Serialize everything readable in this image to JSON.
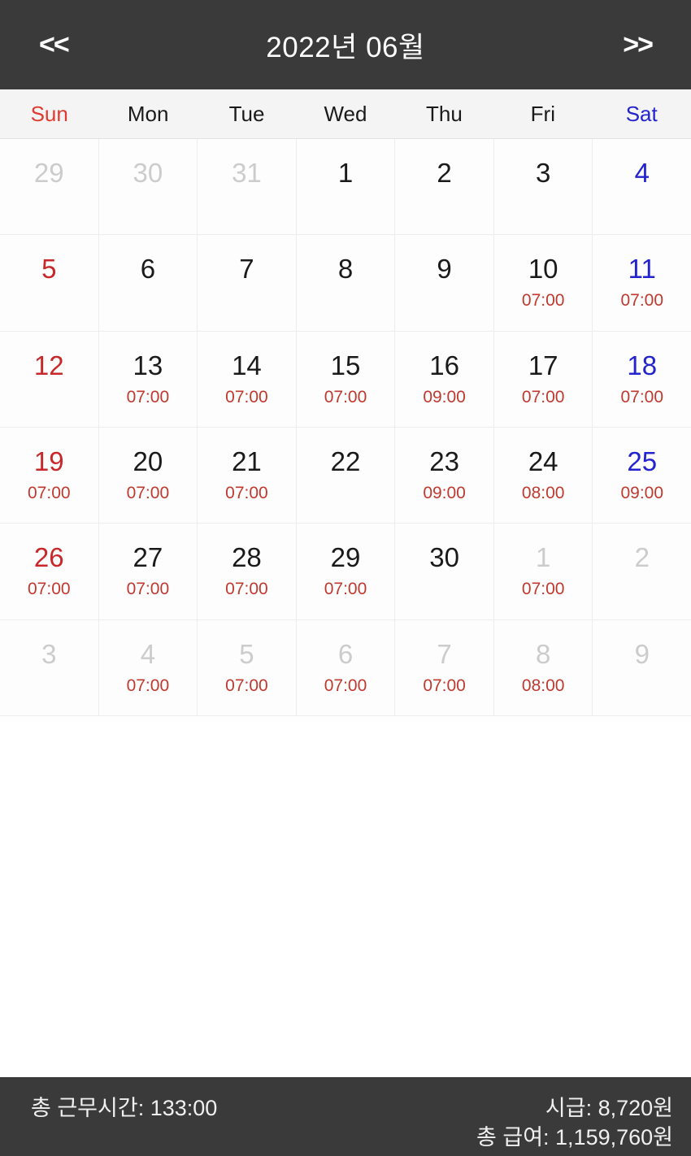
{
  "header": {
    "prev_label": "<<",
    "title": "2022년 06월",
    "next_label": ">>"
  },
  "weekdays": [
    {
      "label": "Sun",
      "kind": "sun"
    },
    {
      "label": "Mon",
      "kind": "weekday"
    },
    {
      "label": "Tue",
      "kind": "weekday"
    },
    {
      "label": "Wed",
      "kind": "weekday"
    },
    {
      "label": "Thu",
      "kind": "weekday"
    },
    {
      "label": "Fri",
      "kind": "weekday"
    },
    {
      "label": "Sat",
      "kind": "sat"
    }
  ],
  "colors": {
    "header_bg": "#3a3a3a",
    "footer_bg": "#3a3a3a",
    "sunday": "#c8282a",
    "saturday": "#2424cf",
    "time_text": "#c0392f",
    "outside_day": "#cccccc",
    "cell_border": "#ededed"
  },
  "calendar": {
    "weeks": [
      [
        {
          "day": "29",
          "time": "",
          "outside": true
        },
        {
          "day": "30",
          "time": "",
          "outside": true
        },
        {
          "day": "31",
          "time": "",
          "outside": true
        },
        {
          "day": "1",
          "time": "",
          "outside": false
        },
        {
          "day": "2",
          "time": "",
          "outside": false
        },
        {
          "day": "3",
          "time": "",
          "outside": false
        },
        {
          "day": "4",
          "time": "",
          "outside": false
        }
      ],
      [
        {
          "day": "5",
          "time": "",
          "outside": false
        },
        {
          "day": "6",
          "time": "",
          "outside": false
        },
        {
          "day": "7",
          "time": "",
          "outside": false
        },
        {
          "day": "8",
          "time": "",
          "outside": false
        },
        {
          "day": "9",
          "time": "",
          "outside": false
        },
        {
          "day": "10",
          "time": "07:00",
          "outside": false
        },
        {
          "day": "11",
          "time": "07:00",
          "outside": false
        }
      ],
      [
        {
          "day": "12",
          "time": "",
          "outside": false
        },
        {
          "day": "13",
          "time": "07:00",
          "outside": false
        },
        {
          "day": "14",
          "time": "07:00",
          "outside": false
        },
        {
          "day": "15",
          "time": "07:00",
          "outside": false
        },
        {
          "day": "16",
          "time": "09:00",
          "outside": false
        },
        {
          "day": "17",
          "time": "07:00",
          "outside": false
        },
        {
          "day": "18",
          "time": "07:00",
          "outside": false
        }
      ],
      [
        {
          "day": "19",
          "time": "07:00",
          "outside": false
        },
        {
          "day": "20",
          "time": "07:00",
          "outside": false
        },
        {
          "day": "21",
          "time": "07:00",
          "outside": false
        },
        {
          "day": "22",
          "time": "",
          "outside": false
        },
        {
          "day": "23",
          "time": "09:00",
          "outside": false
        },
        {
          "day": "24",
          "time": "08:00",
          "outside": false
        },
        {
          "day": "25",
          "time": "09:00",
          "outside": false
        }
      ],
      [
        {
          "day": "26",
          "time": "07:00",
          "outside": false
        },
        {
          "day": "27",
          "time": "07:00",
          "outside": false
        },
        {
          "day": "28",
          "time": "07:00",
          "outside": false
        },
        {
          "day": "29",
          "time": "07:00",
          "outside": false
        },
        {
          "day": "30",
          "time": "",
          "outside": false
        },
        {
          "day": "1",
          "time": "07:00",
          "outside": true
        },
        {
          "day": "2",
          "time": "",
          "outside": true
        }
      ],
      [
        {
          "day": "3",
          "time": "",
          "outside": true
        },
        {
          "day": "4",
          "time": "07:00",
          "outside": true
        },
        {
          "day": "5",
          "time": "07:00",
          "outside": true
        },
        {
          "day": "6",
          "time": "07:00",
          "outside": true
        },
        {
          "day": "7",
          "time": "07:00",
          "outside": true
        },
        {
          "day": "8",
          "time": "08:00",
          "outside": true
        },
        {
          "day": "9",
          "time": "",
          "outside": true
        }
      ]
    ]
  },
  "footer": {
    "total_hours": "총 근무시간: 133:00",
    "hourly_wage": "시급: 8,720원",
    "total_pay": "총 급여: 1,159,760원"
  }
}
